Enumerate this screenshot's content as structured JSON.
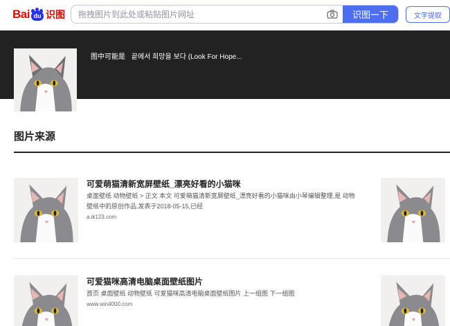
{
  "brand": {
    "bai": "Bai",
    "du": "du",
    "shitu": "识图"
  },
  "search": {
    "placeholder": "拖拽图片到此处或粘贴图片网址",
    "button": "识图一下",
    "ocr_button": "文字提取",
    "camera_icon": "camera-icon"
  },
  "guess": {
    "label": "图中可能是",
    "value": "끝에서 희망을 보다 (Look For Hope..."
  },
  "section": {
    "title": "图片来源"
  },
  "results": [
    {
      "title": "可爱萌猫清新宽屏壁纸_漂亮好看的小猫咪",
      "desc": "桌面壁纸 动物壁纸 > 正文 本文 可爱萌猫清新宽屏壁纸_漂亮好看的小猫咪由小琴编辑整理,是 动物壁纸中的原创作品,发表于2018-05-15,已经",
      "site": "a.ik123.com"
    },
    {
      "title": "可爱猫咪高清电脑桌面壁纸图片",
      "desc": "首页 桌面壁纸 动物壁纸 可爱猫咪高清电脑桌面壁纸图片 上一组图 下一组图",
      "site": "www.win4000.com"
    }
  ],
  "colors": {
    "accent": "#4e6ef2",
    "brand_red": "#e10601",
    "brand_blue": "#2932e1",
    "banner": "#222222"
  }
}
